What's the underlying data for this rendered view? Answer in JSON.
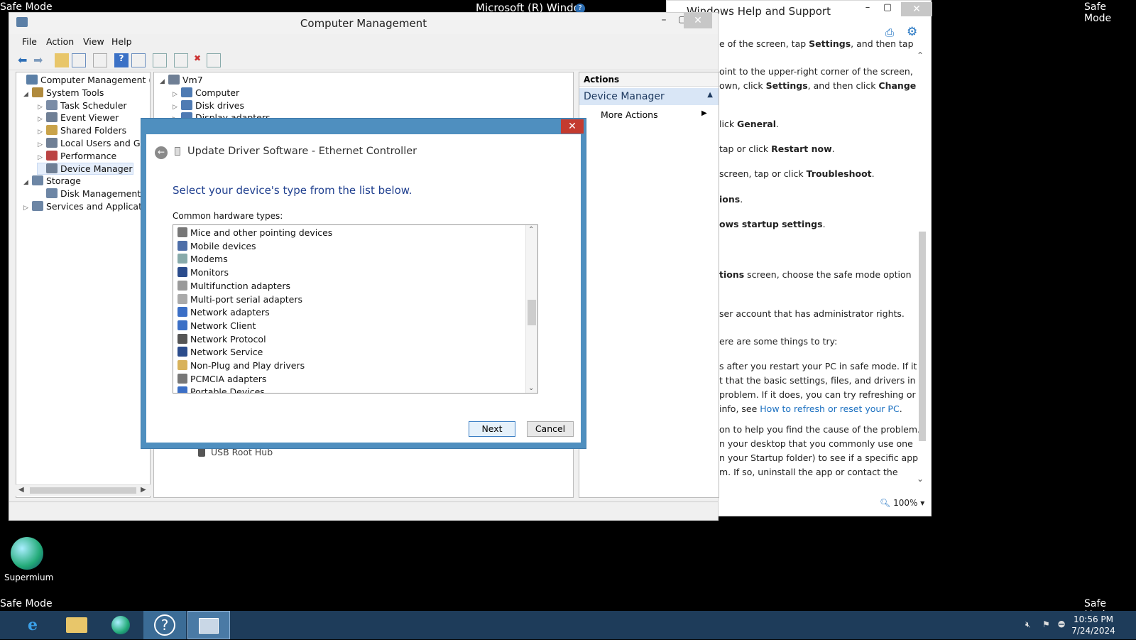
{
  "desktop": {
    "safe_mode_label": "Safe Mode",
    "icon_label": "Supermium"
  },
  "bg_windows": {
    "system_info_title": "Microsoft (R) Windo"
  },
  "help_window": {
    "title": "Windows Help and Support",
    "zoom": "100%",
    "lines": [
      {
        "text": "e of the screen, tap ",
        "bold": "Settings",
        "rest": ", and then tap"
      },
      {
        "text": "oint to the upper-right corner of the screen,",
        "bold": "",
        "rest": ""
      },
      {
        "text": "own, click ",
        "bold": "Settings",
        "rest": ", and then click ",
        "bold2": "Change"
      },
      {
        "text": "lick ",
        "bold": "General",
        "rest": "."
      },
      {
        "text": "tap or click ",
        "bold": "Restart now",
        "rest": "."
      },
      {
        "text": "screen, tap or click ",
        "bold": "Troubleshoot",
        "rest": "."
      },
      {
        "text": "",
        "bold": "ions",
        "rest": "."
      },
      {
        "text": "",
        "bold": "ows startup settings",
        "rest": "."
      },
      {
        "text": "",
        "bold": "tions",
        "rest": " screen, choose the safe mode option"
      },
      {
        "text": "ser account that has administrator rights.",
        "bold": "",
        "rest": ""
      },
      {
        "text": "ere are some things to try:",
        "bold": "",
        "rest": ""
      },
      {
        "text": "s after you restart your PC in safe mode. If it",
        "bold": "",
        "rest": ""
      },
      {
        "text": "t that the basic settings, files, and drivers in",
        "bold": "",
        "rest": ""
      },
      {
        "text": "problem. If it does, you can try refreshing or",
        "bold": "",
        "rest": ""
      },
      {
        "text": "info, see ",
        "link": "How to refresh or reset your PC",
        "rest": "."
      },
      {
        "text": "on to help you find the cause of the problem.",
        "bold": "",
        "rest": ""
      },
      {
        "text": "n your desktop that you commonly use one",
        "bold": "",
        "rest": ""
      },
      {
        "text": "n your Startup folder) to see if a specific app",
        "bold": "",
        "rest": ""
      },
      {
        "text": "m. If so, uninstall the app or contact the",
        "bold": "",
        "rest": ""
      }
    ]
  },
  "cm_window": {
    "title": "Computer Management",
    "menu": [
      "File",
      "Action",
      "View",
      "Help"
    ],
    "tree": [
      {
        "label": "Computer Management (Local",
        "level": 0,
        "arrow": ""
      },
      {
        "label": "System Tools",
        "level": 1,
        "arrow": "◢"
      },
      {
        "label": "Task Scheduler",
        "level": 2,
        "arrow": "▷"
      },
      {
        "label": "Event Viewer",
        "level": 2,
        "arrow": "▷"
      },
      {
        "label": "Shared Folders",
        "level": 2,
        "arrow": "▷"
      },
      {
        "label": "Local Users and Group",
        "level": 2,
        "arrow": "▷"
      },
      {
        "label": "Performance",
        "level": 2,
        "arrow": "▷"
      },
      {
        "label": "Device Manager",
        "level": 2,
        "arrow": ""
      },
      {
        "label": "Storage",
        "level": 1,
        "arrow": "◢"
      },
      {
        "label": "Disk Management",
        "level": 2,
        "arrow": ""
      },
      {
        "label": "Services and Applications",
        "level": 1,
        "arrow": "▷"
      }
    ],
    "center_tree": [
      {
        "label": "Vm7",
        "arrow": "◢"
      },
      {
        "label": "Computer",
        "arrow": "▷"
      },
      {
        "label": "Disk drives",
        "arrow": "▷"
      },
      {
        "label": "Display adapters",
        "arrow": "▷"
      }
    ],
    "center_bottom_item": "USB Root Hub",
    "actions": {
      "header": "Actions",
      "section": "Device Manager",
      "more": "More Actions"
    }
  },
  "dialog": {
    "title": "Update Driver Software - Ethernet Controller",
    "heading": "Select your device's type from the list below.",
    "list_label": "Common hardware types:",
    "items": [
      "Mice and other pointing devices",
      "Mobile devices",
      "Modems",
      "Monitors",
      "Multifunction adapters",
      "Multi-port serial adapters",
      "Network adapters",
      "Network Client",
      "Network Protocol",
      "Network Service",
      "Non-Plug and Play drivers",
      "PCMCIA adapters",
      "Portable Devices"
    ],
    "next_label": "Next",
    "cancel_label": "Cancel"
  },
  "taskbar": {
    "time": "10:56 PM",
    "date": "7/24/2024"
  },
  "colors": {
    "taskbar": "#1e3c5a",
    "dialog_frame": "#4f8fbf",
    "heading_blue": "#1f3f8f",
    "link": "#1a6fc0"
  }
}
